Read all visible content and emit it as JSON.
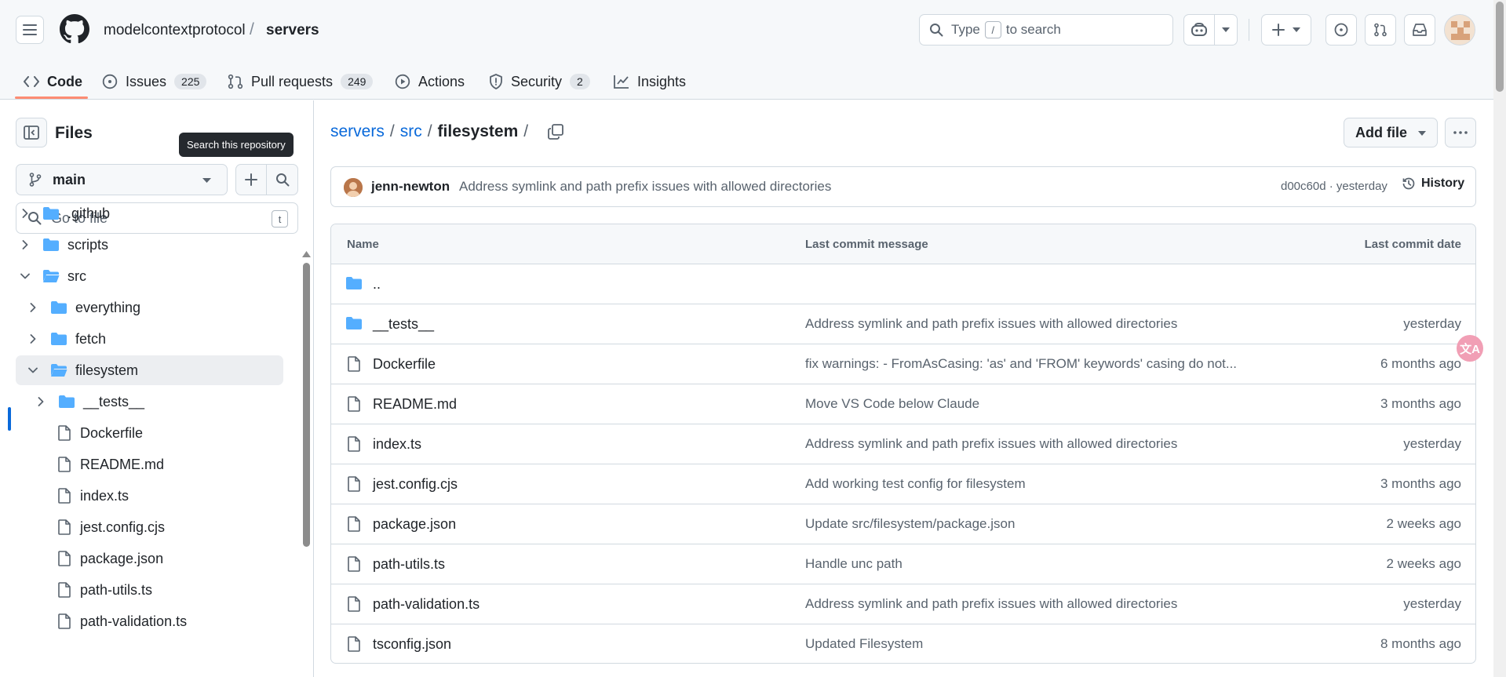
{
  "header": {
    "owner": "modelcontextprotocol",
    "separator": "/",
    "repo": "servers",
    "search_prefix": "Type",
    "search_key": "/",
    "search_suffix": "to search"
  },
  "tabs": [
    {
      "label": "Code",
      "icon": "code-icon"
    },
    {
      "label": "Issues",
      "count": "225",
      "icon": "issue-icon"
    },
    {
      "label": "Pull requests",
      "count": "249",
      "icon": "pull-request-icon"
    },
    {
      "label": "Actions",
      "icon": "play-icon"
    },
    {
      "label": "Security",
      "count": "2",
      "icon": "shield-icon"
    },
    {
      "label": "Insights",
      "icon": "graph-icon"
    }
  ],
  "sidebar": {
    "title": "Files",
    "tooltip": "Search this repository",
    "branch": "main",
    "goto_placeholder": "Go to file",
    "goto_key": "t",
    "tree": [
      {
        "name": ".github",
        "type": "folder"
      },
      {
        "name": "scripts",
        "type": "folder"
      },
      {
        "name": "src",
        "type": "folder-open"
      },
      {
        "name": "everything",
        "type": "folder"
      },
      {
        "name": "fetch",
        "type": "folder"
      },
      {
        "name": "filesystem",
        "type": "folder-open",
        "selected": true
      },
      {
        "name": "__tests__",
        "type": "folder"
      },
      {
        "name": "Dockerfile",
        "type": "file"
      },
      {
        "name": "README.md",
        "type": "file"
      },
      {
        "name": "index.ts",
        "type": "file"
      },
      {
        "name": "jest.config.cjs",
        "type": "file"
      },
      {
        "name": "package.json",
        "type": "file"
      },
      {
        "name": "path-utils.ts",
        "type": "file"
      },
      {
        "name": "path-validation.ts",
        "type": "file"
      }
    ]
  },
  "breadcrumb": {
    "root": "servers",
    "mid": "src",
    "current": "filesystem",
    "sep": "/"
  },
  "actions": {
    "add_file": "Add file"
  },
  "commit": {
    "author": "jenn-newton",
    "message": "Address symlink and path prefix issues with allowed directories",
    "sha_time": "d00c60d · yesterday",
    "history": "History"
  },
  "table": {
    "headers": {
      "name": "Name",
      "message": "Last commit message",
      "date": "Last commit date"
    },
    "parent": "..",
    "rows": [
      {
        "name": "__tests__",
        "type": "folder",
        "message": "Address symlink and path prefix issues with allowed directories",
        "date": "yesterday"
      },
      {
        "name": "Dockerfile",
        "type": "file",
        "message": "fix warnings: - FromAsCasing: 'as' and 'FROM' keywords' casing do not...",
        "date": "6 months ago"
      },
      {
        "name": "README.md",
        "type": "file",
        "message": "Move VS Code below Claude",
        "date": "3 months ago"
      },
      {
        "name": "index.ts",
        "type": "file",
        "message": "Address symlink and path prefix issues with allowed directories",
        "date": "yesterday"
      },
      {
        "name": "jest.config.cjs",
        "type": "file",
        "message": "Add working test config for filesystem",
        "date": "3 months ago"
      },
      {
        "name": "package.json",
        "type": "file",
        "message": "Update src/filesystem/package.json",
        "date": "2 weeks ago"
      },
      {
        "name": "path-utils.ts",
        "type": "file",
        "message": "Handle unc path",
        "date": "2 weeks ago"
      },
      {
        "name": "path-validation.ts",
        "type": "file",
        "message": "Address symlink and path prefix issues with allowed directories",
        "date": "yesterday"
      },
      {
        "name": "tsconfig.json",
        "type": "file",
        "message": "Updated Filesystem",
        "date": "8 months ago"
      }
    ]
  },
  "translate_badge": "文A",
  "colors": {
    "accent": "#0969da",
    "tab_underline": "#fd8c73",
    "folder": "#54aeff"
  }
}
